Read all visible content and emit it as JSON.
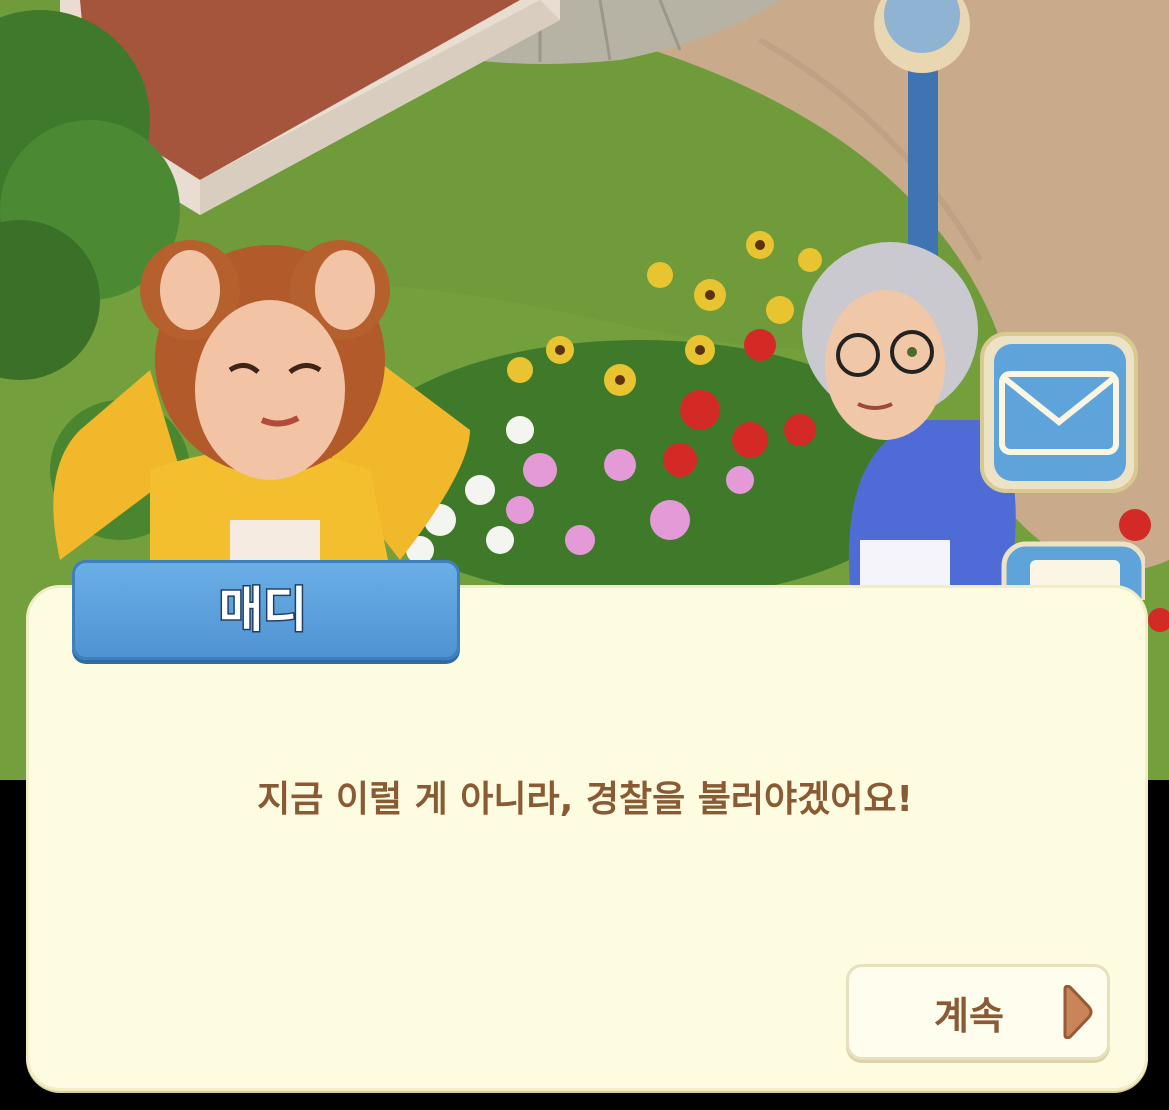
{
  "speaker": {
    "name": "매디"
  },
  "dialogue": {
    "text": "지금 이럴 게 아니라, 경찰을 불러야겠어요!"
  },
  "continue_button": {
    "label": "계속",
    "icon": "play-arrow-icon"
  },
  "side_buttons": {
    "mail_icon": "envelope-icon",
    "second_icon": "notepad-icon"
  },
  "colors": {
    "grass": "#6f9b3a",
    "path": "#c8a88a",
    "dialog_bg": "#fdfbe0",
    "name_tab": "#5ba0dc",
    "text": "#8a5a35"
  }
}
